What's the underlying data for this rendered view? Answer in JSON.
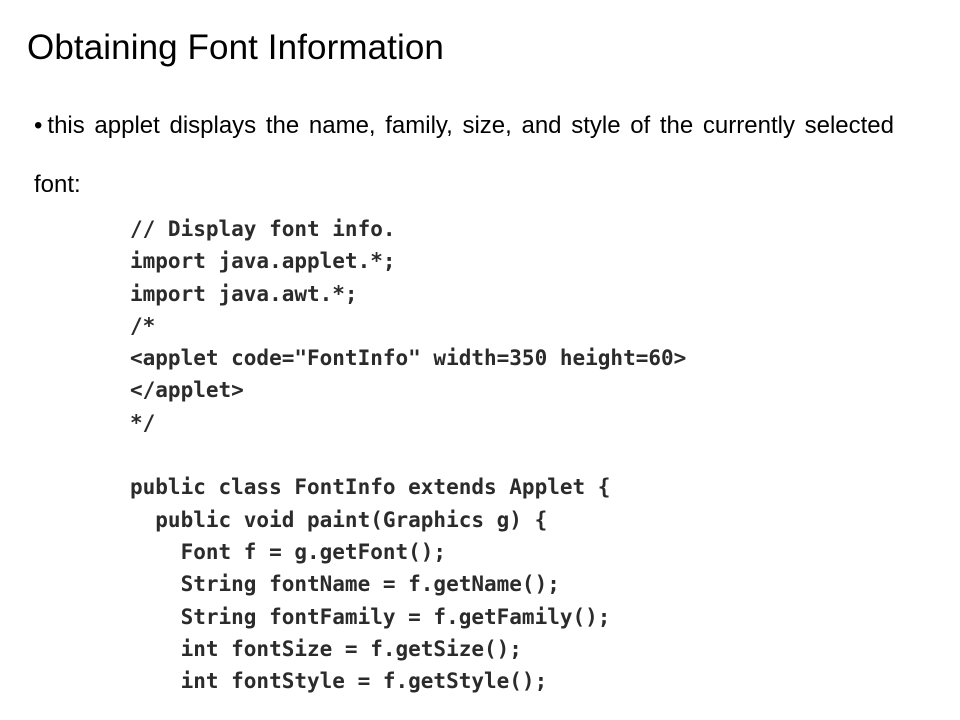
{
  "slide": {
    "title": "Obtaining Font Information",
    "bullet": {
      "marker": "•",
      "text": "this applet displays the name, family, size, and style of the currently selected font:"
    },
    "code": [
      "// Display font info.",
      "import java.applet.*;",
      "import java.awt.*;",
      "/*",
      "<applet code=\"FontInfo\" width=350 height=60>",
      "</applet>",
      "*/",
      "",
      "public class FontInfo extends Applet {",
      "  public void paint(Graphics g) {",
      "    Font f = g.getFont();",
      "    String fontName = f.getName();",
      "    String fontFamily = f.getFamily();",
      "    int fontSize = f.getSize();",
      "    int fontStyle = f.getStyle();"
    ]
  }
}
